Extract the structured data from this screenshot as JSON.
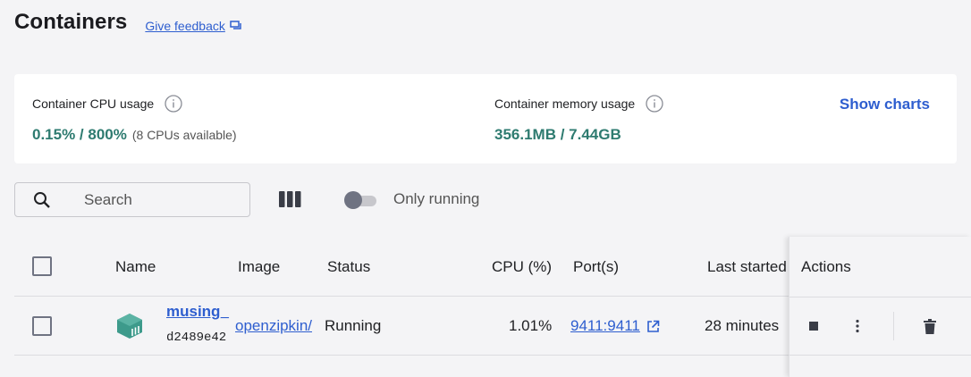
{
  "header": {
    "title": "Containers",
    "feedback_label": "Give feedback"
  },
  "stats": {
    "cpu": {
      "label": "Container CPU usage",
      "value": "0.15% / 800%",
      "sub": "(8 CPUs available)"
    },
    "memory": {
      "label": "Container memory usage",
      "value": "356.1MB / 7.44GB"
    },
    "show_charts_label": "Show charts"
  },
  "toolbar": {
    "search_placeholder": "Search",
    "only_running_label": "Only running",
    "only_running_on": false
  },
  "table": {
    "headers": {
      "name": "Name",
      "image": "Image",
      "status": "Status",
      "cpu": "CPU (%)",
      "ports": "Port(s)",
      "last_started": "Last started",
      "actions": "Actions"
    },
    "rows": [
      {
        "name": "musing_",
        "id": "d2489e42",
        "image": "openzipkin/",
        "status": "Running",
        "cpu": "1.01%",
        "ports": "9411:9411",
        "last_started": "28 minutes"
      }
    ]
  },
  "colors": {
    "accent": "#2e5ecf",
    "stat": "#2e7b70",
    "container_icon": "#3d9a8b"
  },
  "icons": [
    "info-icon",
    "search-icon",
    "columns-icon",
    "chat-icon",
    "external-link-icon",
    "container-icon",
    "stop-icon",
    "more-vert-icon",
    "trash-icon"
  ]
}
